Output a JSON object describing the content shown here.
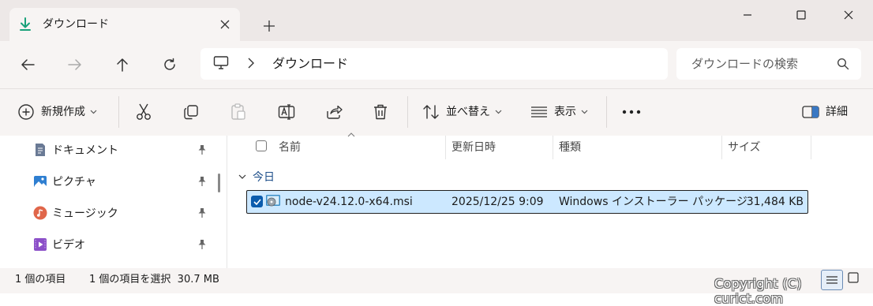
{
  "tab": {
    "title": "ダウンロード",
    "icon": "download-icon"
  },
  "window_controls": [
    "minimize-icon",
    "maximize-icon",
    "close-icon"
  ],
  "nav": {
    "breadcrumb": "ダウンロード",
    "search_placeholder": "ダウンロードの検索"
  },
  "toolbar": {
    "new_label": "新規作成",
    "sort_label": "並べ替え",
    "view_label": "表示",
    "details_label": "詳細"
  },
  "sidebar": {
    "items": [
      {
        "label": "ドキュメント",
        "icon": "documents-icon"
      },
      {
        "label": "ピクチャ",
        "icon": "pictures-icon"
      },
      {
        "label": "ミュージック",
        "icon": "music-icon"
      },
      {
        "label": "ビデオ",
        "icon": "videos-icon"
      }
    ]
  },
  "columns": {
    "name": "名前",
    "modified": "更新日時",
    "type": "種類",
    "size": "サイズ"
  },
  "group": {
    "label": "今日"
  },
  "files": [
    {
      "name": "node-v24.12.0-x64.msi",
      "modified": "2025/12/25 9:09",
      "type": "Windows インストーラー パッケージ",
      "size": "31,484 KB",
      "selected": true
    }
  ],
  "status": {
    "count": "1 個の項目",
    "selection": "1 個の項目を選択  30.7 MB"
  },
  "watermark": "Copyright (C) curict.com",
  "colors": {
    "accent": "#0b5cad",
    "selection": "#cce8ff",
    "download_icon": "#1aa17a"
  }
}
